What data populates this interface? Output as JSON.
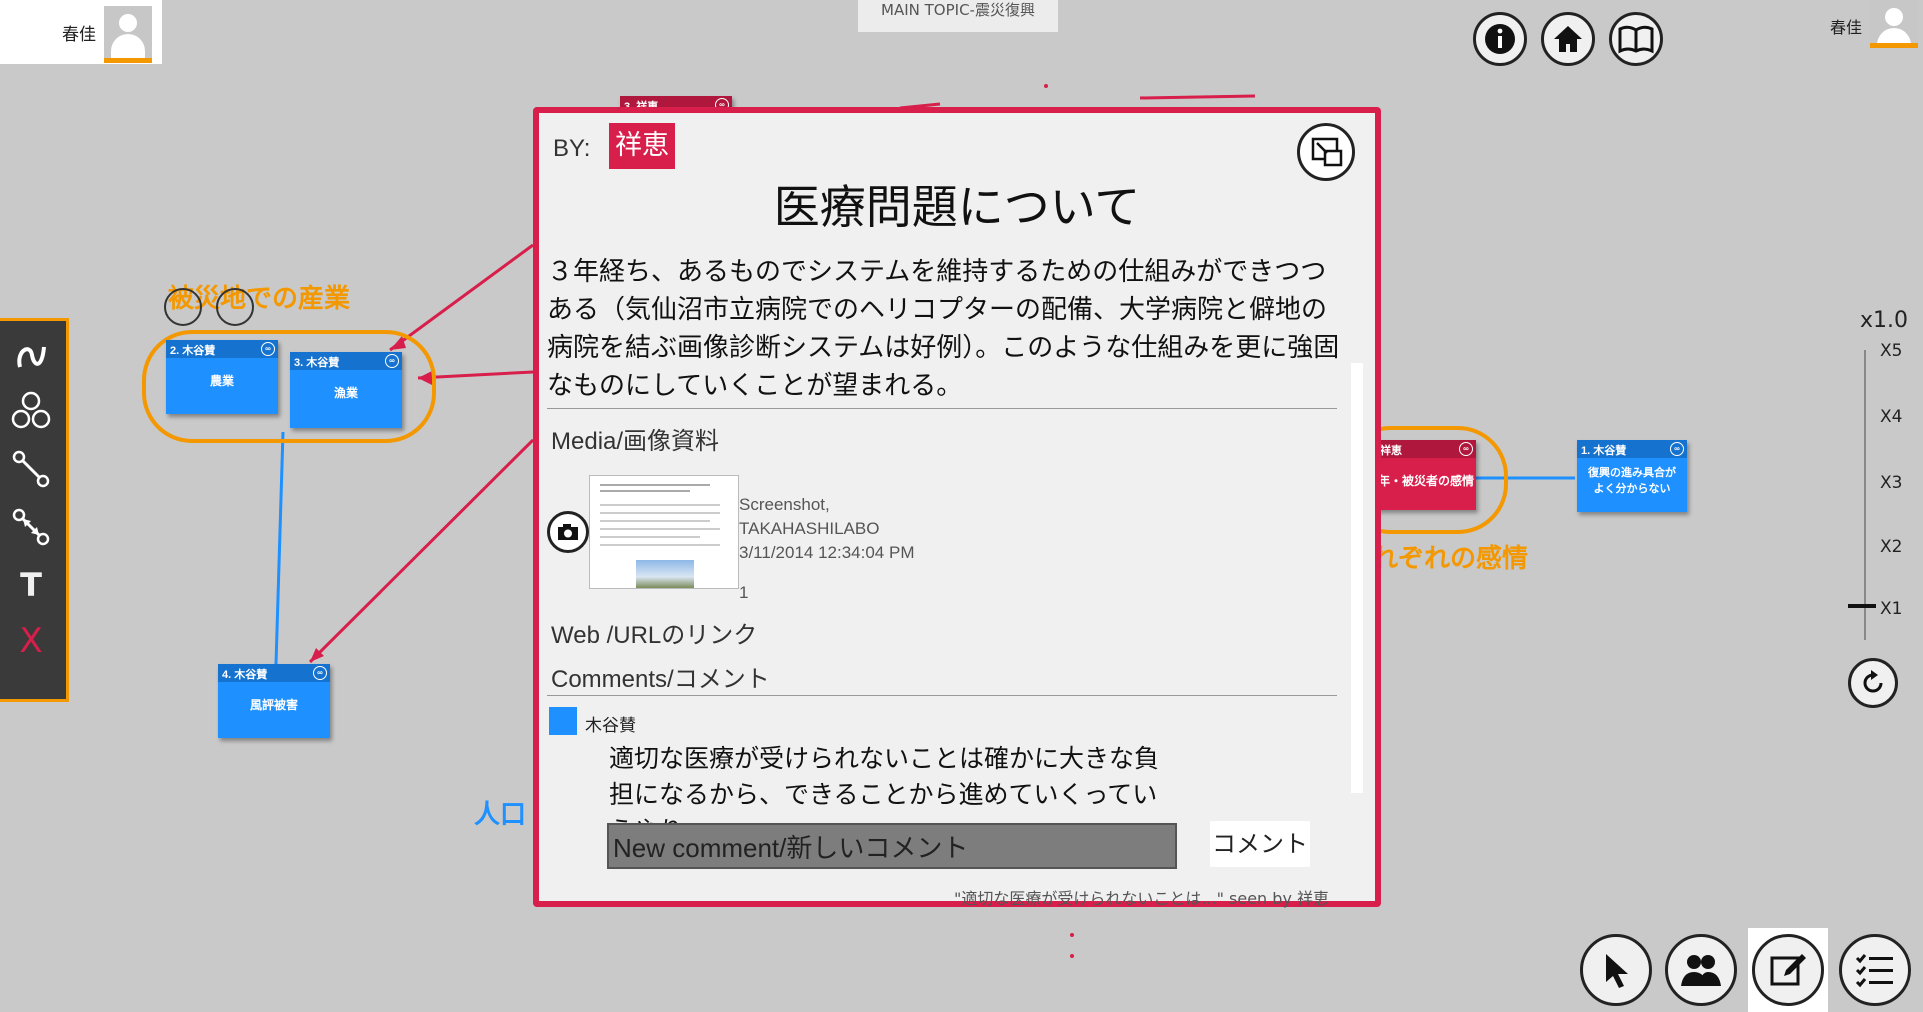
{
  "header": {
    "main_topic": "MAIN TOPIC-震災復興",
    "left_user": "春佳",
    "right_user": "春佳"
  },
  "top_buttons": {
    "info": "info-icon",
    "home": "home-icon",
    "book": "book-icon"
  },
  "palette": {
    "tools": [
      "freehand-icon",
      "circles-icon",
      "connector-icon",
      "double-connector-icon",
      "text-icon",
      "delete-icon"
    ],
    "text_tool": "T",
    "delete_tool": "X"
  },
  "map": {
    "group_industry": "被災地での産業",
    "group_emotion": "れぞれの感情",
    "group_population": "人口",
    "nodes": [
      {
        "header": "2. 木谷賛",
        "body": "農業"
      },
      {
        "header": "3. 木谷賛",
        "body": "漁業"
      },
      {
        "header": "4. 木谷賛",
        "body": "風評被害"
      },
      {
        "header": "祥恵",
        "body": "年・被災者の感情"
      },
      {
        "header": "1. 木谷賛",
        "body": "復興の進み具合が\nよく分からない"
      },
      {
        "header": "3. 祥恵",
        "body": ""
      }
    ]
  },
  "zoom": {
    "current": "x1.0",
    "ticks": [
      "X5",
      "X4",
      "X3",
      "X2",
      "X1"
    ],
    "level": 1
  },
  "modal": {
    "by_label": "BY:",
    "by_name": "祥恵",
    "title": "医療問題について",
    "body": "３年経ち、あるものでシステムを維持するための仕組みができつつある（気仙沼市立病院でのヘリコプターの配備、大学病院と僻地の病院を結ぶ画像診断システムは好例）。このような仕組みを更に強固なものにしていくことが望まれる。",
    "media_label": "Media/画像資料",
    "media": {
      "line1": "Screenshot,",
      "line2": "TAKAHASHILABO",
      "line3": "3/11/2014 12:34:04 PM",
      "count": "1"
    },
    "web_label": "Web /URLのリンク",
    "comments_label": "Comments/コメント",
    "comment": {
      "user": "木谷賛",
      "text": "適切な医療が受けられないことは確かに大きな負担になるから、できることから進めていくっていうやり"
    },
    "new_comment_value": "New comment/新しいコメント",
    "comment_button": "コメント",
    "seen_by": "\"適切な医療が受けられないことは...\" seen by 祥恵"
  },
  "bottom_buttons": [
    "pointer-icon",
    "users-icon",
    "edit-icon",
    "list-icon"
  ],
  "colors": {
    "accent_orange": "#f39800",
    "accent_red": "#d81e4a",
    "node_blue": "#1e90ff"
  }
}
